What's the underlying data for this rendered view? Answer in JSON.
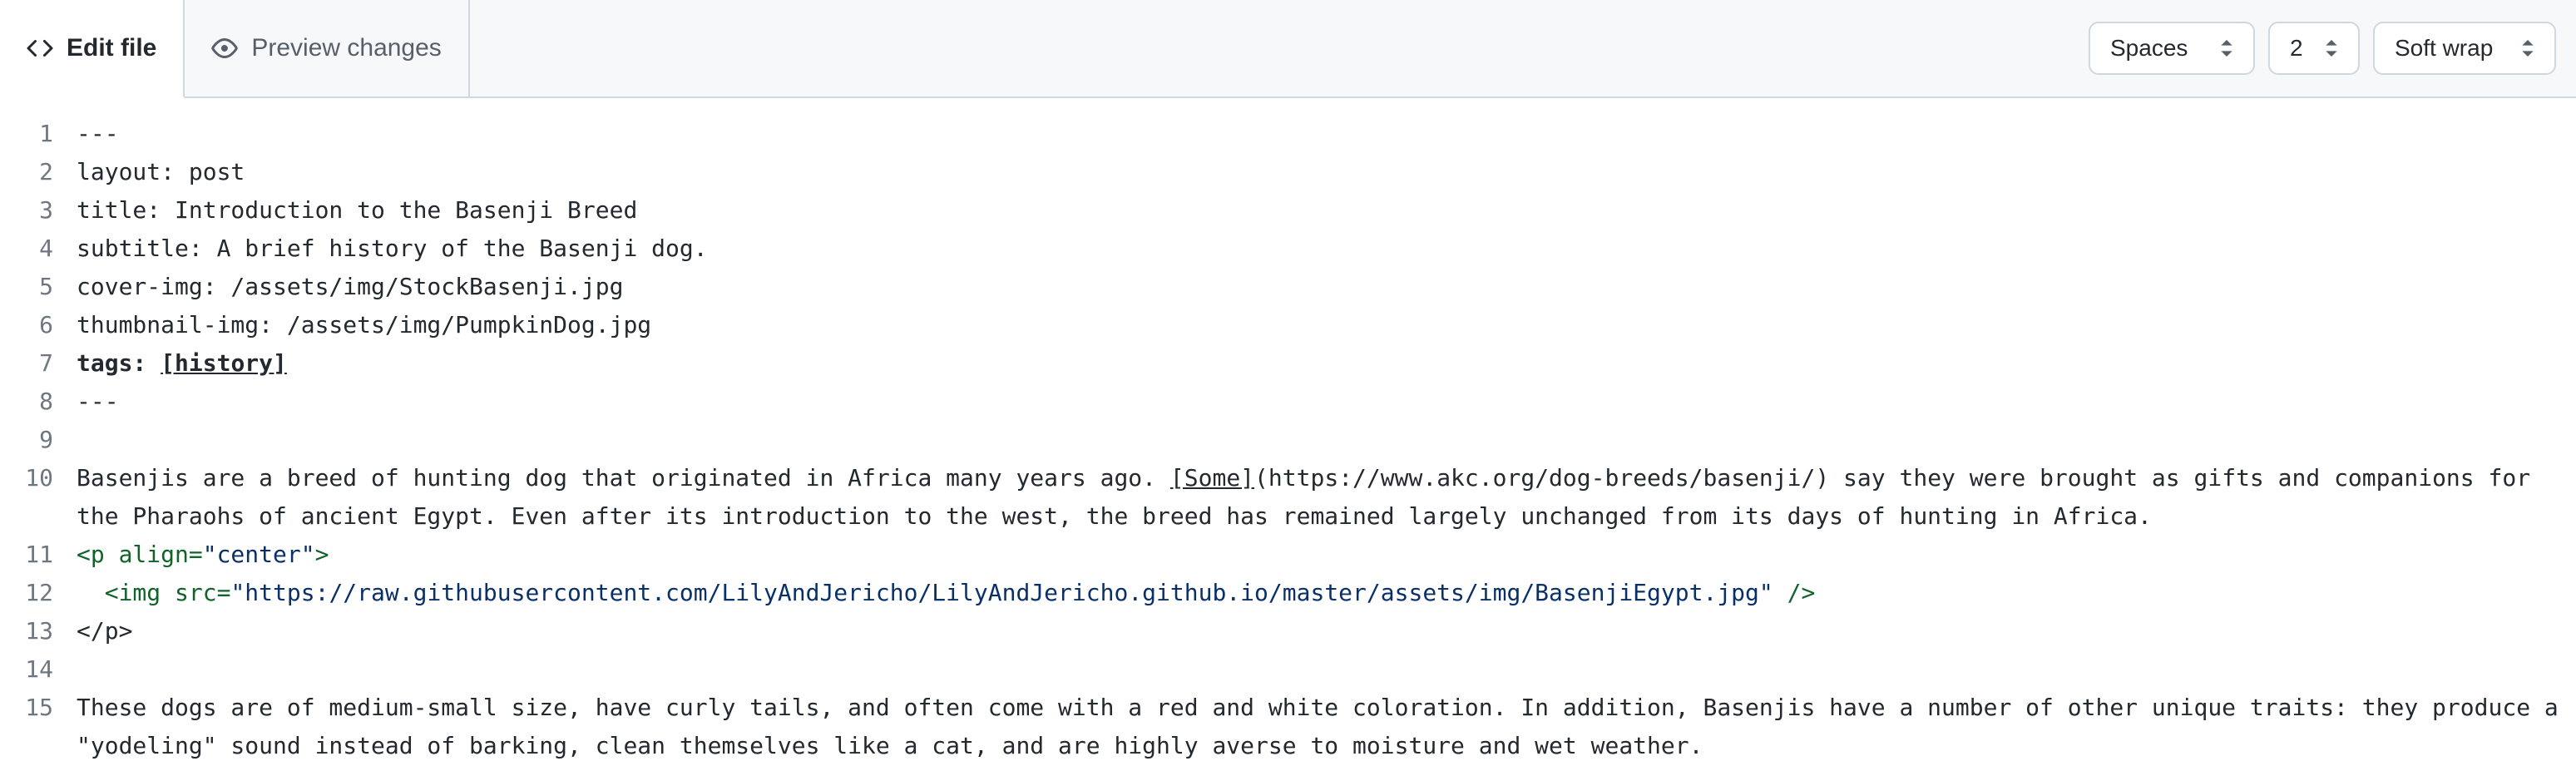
{
  "toolbar": {
    "edit_tab": "Edit file",
    "preview_tab": "Preview changes",
    "indent_mode": "Spaces",
    "indent_size": "2",
    "wrap_mode": "Soft wrap"
  },
  "editor": {
    "lines": [
      {
        "n": 1,
        "type": "plain",
        "text": "---"
      },
      {
        "n": 2,
        "type": "plain",
        "text": "layout: post"
      },
      {
        "n": 3,
        "type": "plain",
        "text": "title: Introduction to the Basenji Breed"
      },
      {
        "n": 4,
        "type": "plain",
        "text": "subtitle: A brief history of the Basenji dog."
      },
      {
        "n": 5,
        "type": "plain",
        "text": "cover-img: /assets/img/StockBasenji.jpg"
      },
      {
        "n": 6,
        "type": "plain",
        "text": "thumbnail-img: /assets/img/PumpkinDog.jpg"
      },
      {
        "n": 7,
        "type": "tags",
        "prefix": "tags: ",
        "value": "[history]"
      },
      {
        "n": 8,
        "type": "plain",
        "text": "---"
      },
      {
        "n": 9,
        "type": "plain",
        "text": ""
      },
      {
        "n": 10,
        "type": "para1",
        "a": "Basenjis are a breed of hunting dog that originated in Africa many years ago. ",
        "link_text": "[Some]",
        "link_url": "(https://www.akc.org/dog-breeds/basenji/)",
        "b": " say they were brought as gifts and companions for the Pharaohs of ancient Egypt. Even after its introduction to the west, the breed has remained largely unchanged from its days of hunting in Africa."
      },
      {
        "n": 11,
        "type": "html_open",
        "a": "<p align=",
        "q": "\"center\"",
        "b": ">"
      },
      {
        "n": 12,
        "type": "html_img",
        "a": "  <img src=",
        "q": "\"https://raw.githubusercontent.com/LilyAndJericho/LilyAndJericho.github.io/master/assets/img/BasenjiEgypt.jpg\"",
        "b": " />"
      },
      {
        "n": 13,
        "type": "plain",
        "text": "</p>"
      },
      {
        "n": 14,
        "type": "plain",
        "text": ""
      },
      {
        "n": 15,
        "type": "plain",
        "text": "These dogs are of medium-small size, have curly tails, and often come with a red and white coloration. In addition, Basenjis have a number of other unique traits: they produce a \"yodeling\" sound instead of barking, clean themselves like a cat, and are highly averse to moisture and wet weather."
      }
    ]
  }
}
